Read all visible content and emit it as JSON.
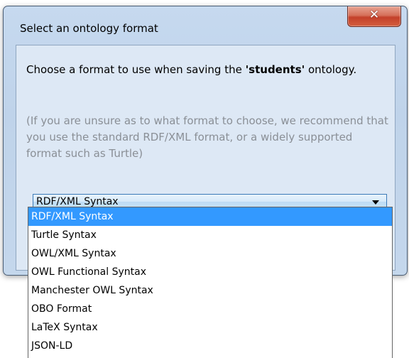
{
  "dialog": {
    "title": "Select an ontology format",
    "close_icon": "close-icon",
    "intro_prefix": "Choose a format to use when saving the ",
    "ontology_name": "'students'",
    "intro_suffix": " ontology.",
    "hint": "(If you are unsure as to what format to choose, we recommend that you use the standard RDF/XML format, or a widely supported format such as Turtle)",
    "format_select": {
      "selected": "RDF/XML Syntax",
      "icon": "chevron-down-icon",
      "options": [
        "RDF/XML Syntax",
        "Turtle Syntax",
        "OWL/XML Syntax",
        "OWL Functional Syntax",
        "Manchester OWL Syntax",
        "OBO Format",
        "LaTeX Syntax",
        "JSON-LD"
      ],
      "highlighted_index": 0
    }
  },
  "colors": {
    "selection": "#3399ff",
    "hint_text": "#8a8f96",
    "close_button": "#c4402a"
  }
}
